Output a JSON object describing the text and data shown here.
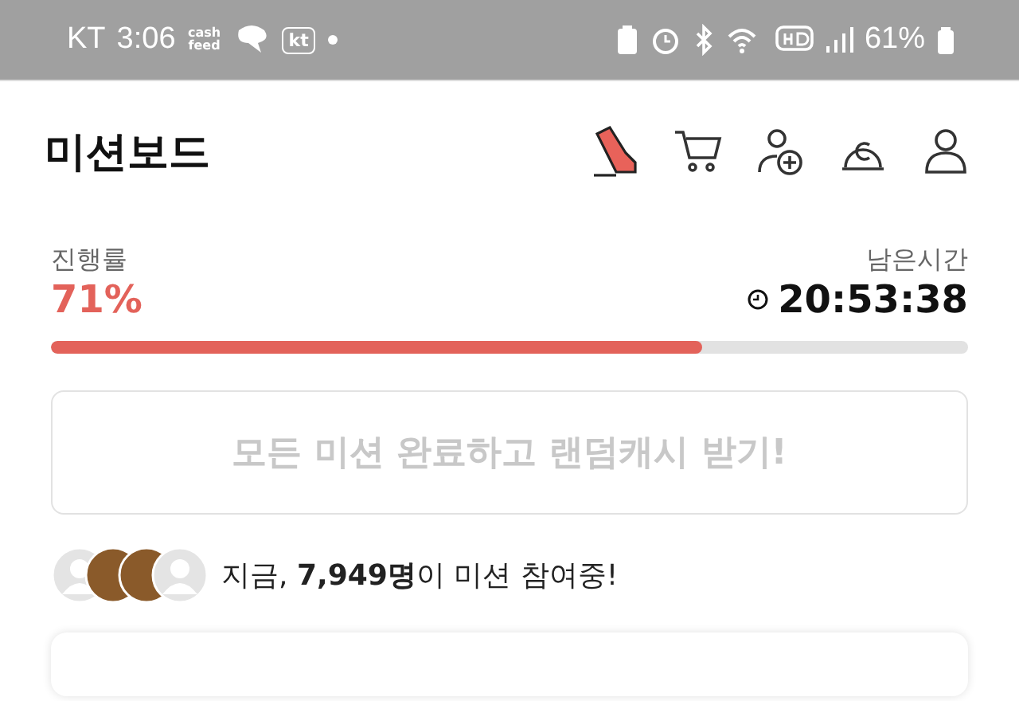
{
  "status_bar": {
    "carrier": "KT",
    "time": "3:06",
    "cashfeed_logo": "cash feed",
    "kt_badge": "kt",
    "battery": "61%"
  },
  "header": {
    "title": "미션보드"
  },
  "progress": {
    "label": "진행률",
    "value": "71%",
    "level": 0.71,
    "time_label": "남은시간",
    "time": "20:53:38"
  },
  "reward_button": {
    "label": "모든 미션 완료하고 랜덤캐시 받기!",
    "disabled": true
  },
  "participants": {
    "avatars": [
      {
        "kind": "default"
      },
      {
        "kind": "photo"
      },
      {
        "kind": "photo"
      },
      {
        "kind": "default"
      }
    ],
    "text": "지금, **7,949명**이 미션 참여중!"
  }
}
